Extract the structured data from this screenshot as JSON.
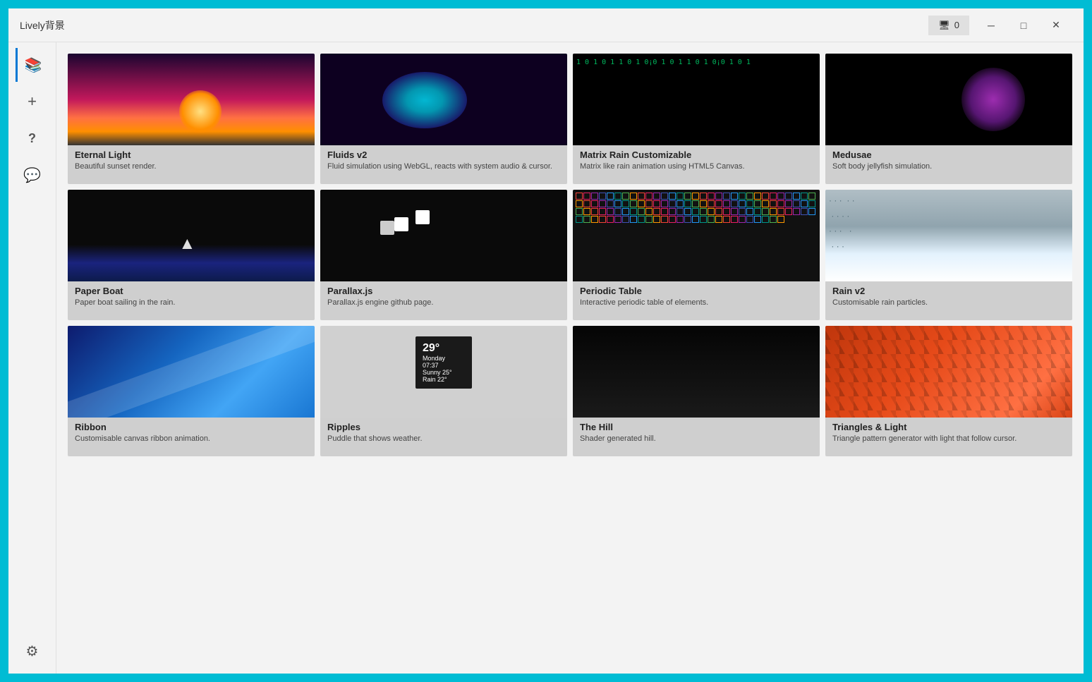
{
  "app": {
    "title": "Lively背景",
    "monitor_label": "0"
  },
  "titlebar": {
    "minimize_label": "─",
    "maximize_label": "□",
    "close_label": "✕"
  },
  "sidebar": {
    "items": [
      {
        "id": "library",
        "icon": "📚",
        "label": "Library",
        "active": true
      },
      {
        "id": "add",
        "icon": "+",
        "label": "Add"
      },
      {
        "id": "help",
        "icon": "?",
        "label": "Help"
      },
      {
        "id": "feedback",
        "icon": "💬",
        "label": "Feedback"
      }
    ],
    "settings": {
      "icon": "⚙",
      "label": "Settings"
    }
  },
  "wallpapers": [
    {
      "id": "eternal-light",
      "title": "Eternal Light",
      "description": "Beautiful sunset render."
    },
    {
      "id": "fluids-v2",
      "title": "Fluids v2",
      "description": "Fluid simulation using WebGL, reacts with system audio & cursor."
    },
    {
      "id": "matrix-rain",
      "title": "Matrix Rain Customizable",
      "description": "Matrix like rain animation using HTML5 Canvas."
    },
    {
      "id": "medusae",
      "title": "Medusae",
      "description": "Soft body jellyfish simulation."
    },
    {
      "id": "paper-boat",
      "title": "Paper Boat",
      "description": "Paper boat sailing in the rain."
    },
    {
      "id": "parallax-js",
      "title": "Parallax.js",
      "description": "Parallax.js engine github page."
    },
    {
      "id": "periodic-table",
      "title": "Periodic Table",
      "description": "Interactive periodic table of elements."
    },
    {
      "id": "rain-v2",
      "title": "Rain v2",
      "description": "Customisable rain particles."
    },
    {
      "id": "ribbon",
      "title": "Ribbon",
      "description": "Customisable canvas ribbon animation."
    },
    {
      "id": "ripples",
      "title": "Ripples",
      "description": "Puddle that shows weather."
    },
    {
      "id": "the-hill",
      "title": "The Hill",
      "description": "Shader generated hill."
    },
    {
      "id": "triangles-light",
      "title": "Triangles & Light",
      "description": "Triangle pattern generator with light that follow cursor."
    }
  ],
  "weather": {
    "temp": "29°",
    "line1": "Monday",
    "line2": "07:37",
    "line3": "Sunny 25°",
    "line4": "Rain 22°"
  }
}
